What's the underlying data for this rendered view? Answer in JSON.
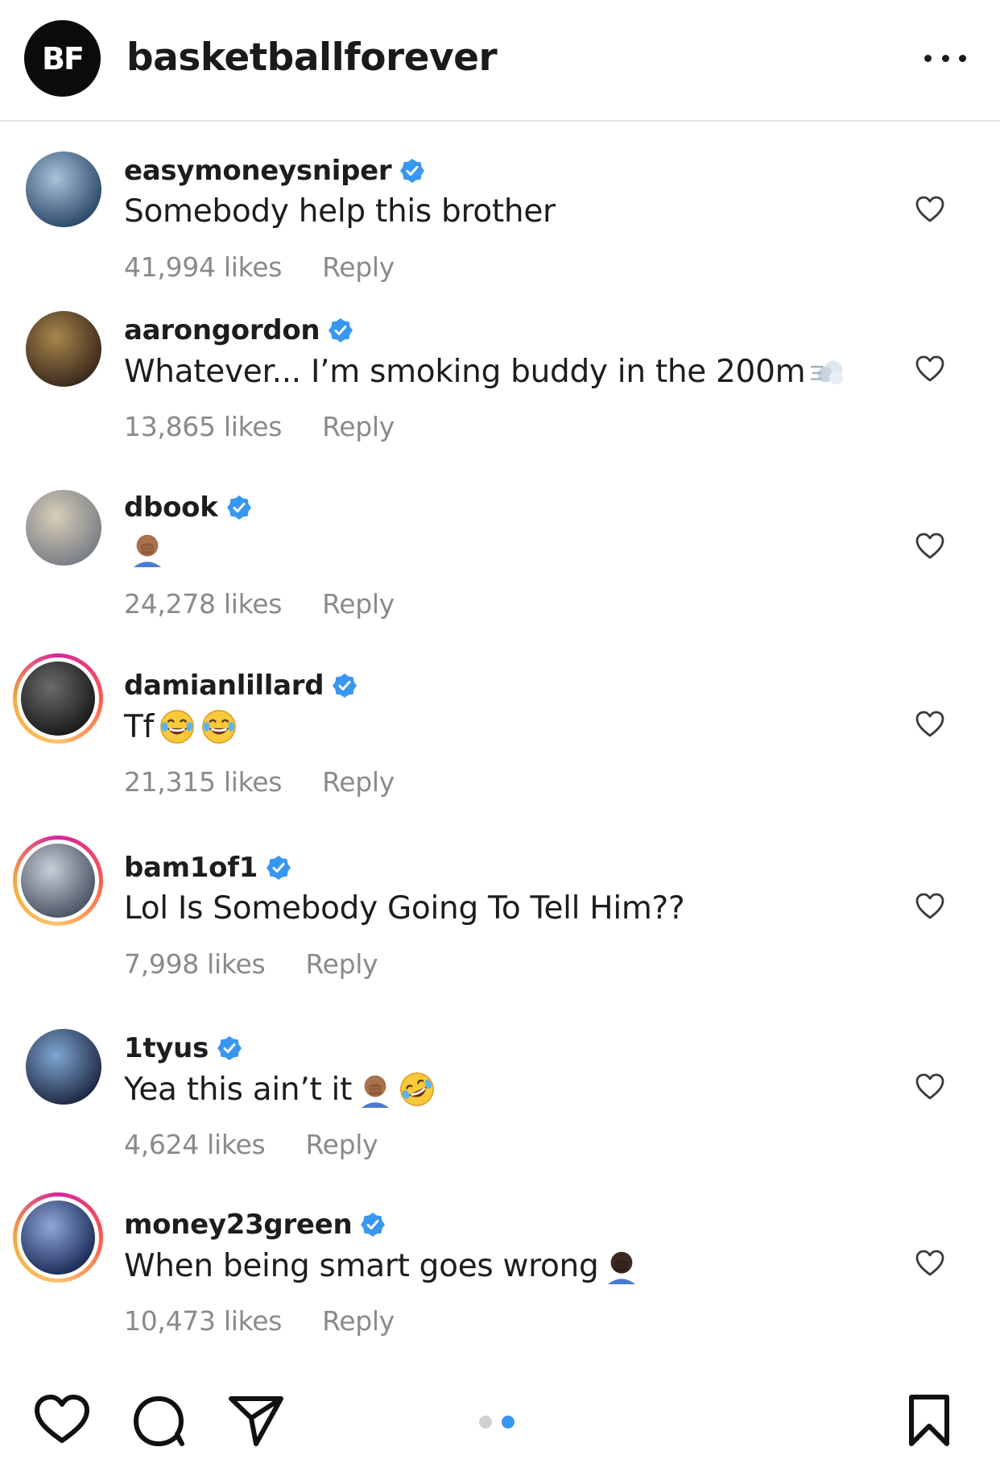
{
  "header": {
    "account_name": "basketballforever",
    "avatar_text": "BF"
  },
  "comments": [
    {
      "username": "easymoneysniper",
      "verified": true,
      "text": "Somebody help this brother",
      "emojis": [],
      "likes": "41,994 likes",
      "reply": "Reply",
      "story_ring": false,
      "avatar_colors": [
        "#2d4a6a",
        "#a9c2d9"
      ]
    },
    {
      "username": "aarongordon",
      "verified": true,
      "text": "Whatever... I’m smoking buddy in the 200m",
      "emojis": [
        "dash-emoji"
      ],
      "likes": "13,865 likes",
      "reply": "Reply",
      "story_ring": false,
      "avatar_colors": [
        "#3b2a1c",
        "#a8864d"
      ]
    },
    {
      "username": "dbook",
      "verified": true,
      "text": "",
      "emojis": [
        "facepalm-emoji"
      ],
      "likes": "24,278 likes",
      "reply": "Reply",
      "story_ring": false,
      "avatar_colors": [
        "#7a7f86",
        "#d8cdb9"
      ]
    },
    {
      "username": "damianlillard",
      "verified": true,
      "text": "Tf",
      "emojis": [
        "joy-emoji",
        "joy-emoji"
      ],
      "likes": "21,315 likes",
      "reply": "Reply",
      "story_ring": true,
      "avatar_colors": [
        "#1b1b1b",
        "#6b6b6b"
      ]
    },
    {
      "username": "bam1of1",
      "verified": true,
      "text": "Lol Is Somebody Going To Tell Him??",
      "emojis": [],
      "likes": "7,998 likes",
      "reply": "Reply",
      "story_ring": true,
      "avatar_colors": [
        "#4b5566",
        "#c9cfd8"
      ]
    },
    {
      "username": "1tyus",
      "verified": true,
      "text": "Yea this ain’t it",
      "emojis": [
        "facepalm-emoji",
        "rofl-emoji"
      ],
      "likes": "4,624 likes",
      "reply": "Reply",
      "story_ring": false,
      "avatar_colors": [
        "#1f2a44",
        "#7fa7d4"
      ]
    },
    {
      "username": "money23green",
      "verified": true,
      "text": "When being smart goes wrong",
      "emojis": [
        "facepalm-dark-emoji"
      ],
      "likes": "10,473 likes",
      "reply": "Reply",
      "story_ring": true,
      "avatar_colors": [
        "#1d2d5a",
        "#8fa7d8"
      ]
    }
  ],
  "colors": {
    "verified": "#3897f0",
    "muted_text": "#8a8a8a",
    "active_dot": "#3897f0",
    "inactive_dot": "#d0d0d0"
  },
  "carousel": {
    "total": 2,
    "active_index": 1
  }
}
